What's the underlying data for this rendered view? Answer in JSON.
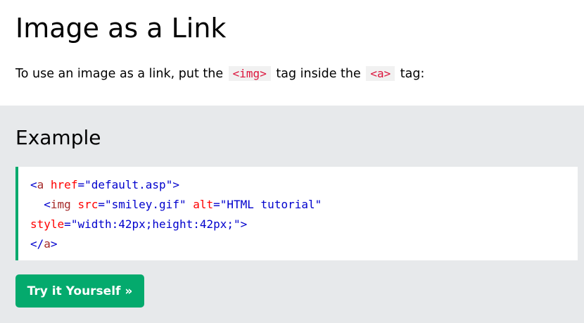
{
  "header": {
    "title": "Image as a Link",
    "intro_before": "To use an image as a link, put the ",
    "intro_code_img": "<img>",
    "intro_middle": " tag inside the ",
    "intro_code_a": "<a>",
    "intro_after": " tag:"
  },
  "example": {
    "title": "Example",
    "code": {
      "line1_open": "<",
      "line1_tag": "a",
      "line1_attr": " href",
      "line1_eq": "=",
      "line1_val": "\"default.asp\"",
      "line1_close": ">",
      "line2_indent": "  ",
      "line2_open": "<",
      "line2_tag": "img",
      "line2_attr1": " src",
      "line2_eq1": "=",
      "line2_val1": "\"smiley.gif\"",
      "line2_attr2": " alt",
      "line2_eq2": "=",
      "line2_val2": "\"HTML tutorial\"",
      "line3_attr": "style",
      "line3_eq": "=",
      "line3_val": "\"width:42px;height:42px;\"",
      "line3_close": ">",
      "line4_open": "</",
      "line4_tag": "a",
      "line4_close": ">"
    },
    "button_label": "Try it Yourself »"
  },
  "colors": {
    "accent": "#04aa6d",
    "panel_bg": "#e7e9eb",
    "inline_code": "#dc143c"
  }
}
